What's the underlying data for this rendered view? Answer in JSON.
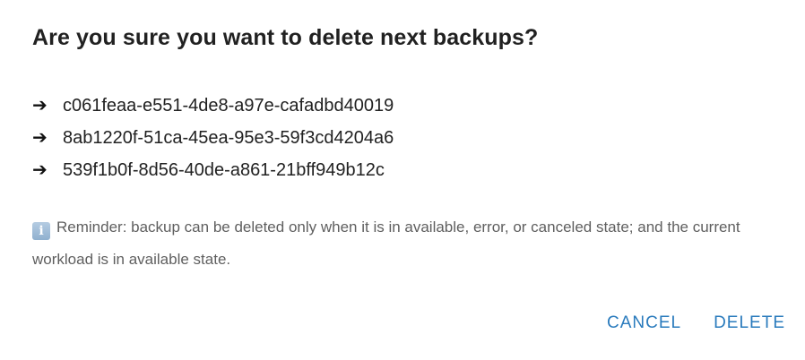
{
  "dialog": {
    "title": "Are you sure you want to delete next backups?",
    "arrow_icon": "right-arrow-icon",
    "backups": [
      "c061feaa-e551-4de8-a97e-cafadbd40019",
      "8ab1220f-51ca-45ea-95e3-59f3cd4204a6",
      "539f1b0f-8d56-40de-a861-21bff949b12c"
    ],
    "reminder": {
      "icon": "info-icon",
      "icon_glyph": "i",
      "text": "Reminder: backup can be deleted only when it is in available, error, or canceled state; and the current workload is in available state."
    },
    "actions": {
      "cancel_label": "CANCEL",
      "delete_label": "DELETE"
    },
    "colors": {
      "accent": "#2a7bbd",
      "text": "#212121",
      "muted": "#5f5f5f"
    }
  }
}
